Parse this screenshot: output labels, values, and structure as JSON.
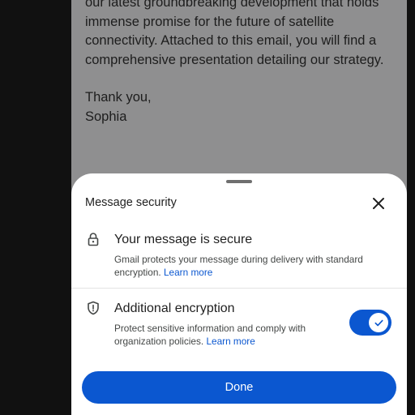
{
  "email": {
    "body_lines": [
      "our latest groundbreaking development that holds",
      "immense promise for the future of satellite",
      "connectivity. Attached to this email, you will find a",
      "comprehensive presentation detailing our strategy."
    ],
    "closing": "Thank you,",
    "signature": "Sophia"
  },
  "sheet": {
    "title": "Message security",
    "close_icon": "close-icon",
    "secure": {
      "icon": "lock-icon",
      "title": "Your message is secure",
      "desc_line1": "Gmail protects your message during delivery with standard",
      "desc_line2": "encryption.",
      "link": "Learn more"
    },
    "encryption": {
      "icon": "shield-icon",
      "title": "Additional encryption",
      "desc_line1": "Protect sensitive information and comply with",
      "desc_line2": "organization policies.",
      "link": "Learn more",
      "toggle_on": true
    },
    "done_label": "Done"
  },
  "colors": {
    "accent": "#0b57d0",
    "scrim_bg": "#8f8f90",
    "sheet_bg": "#ffffff"
  }
}
